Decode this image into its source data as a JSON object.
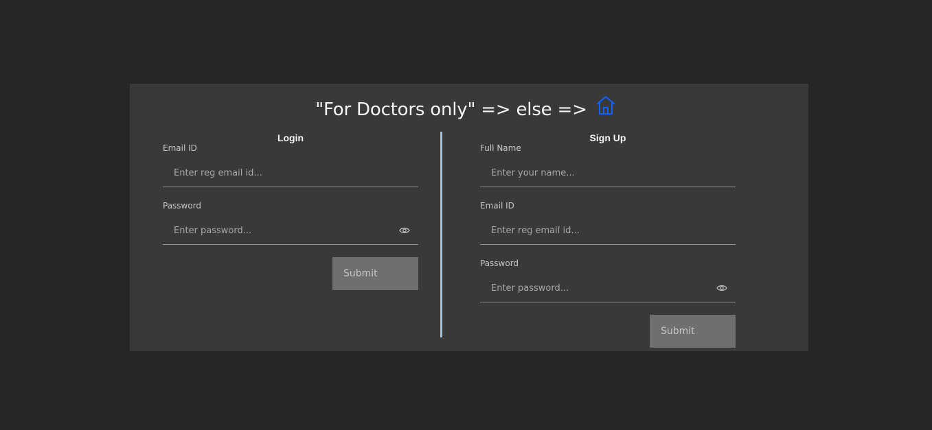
{
  "header": {
    "title": "\"For Doctors only\" => else =>",
    "home_icon": "home-icon",
    "home_icon_color": "#0f62fe"
  },
  "login": {
    "title": "Login",
    "email_label": "Email ID",
    "email_placeholder": "Enter reg email id...",
    "email_value": "",
    "password_label": "Password",
    "password_placeholder": "Enter password...",
    "password_value": "",
    "password_toggle_icon": "eye-icon",
    "submit_label": "Submit"
  },
  "signup": {
    "title": "Sign Up",
    "name_label": "Full Name",
    "name_placeholder": "Enter your name...",
    "name_value": "",
    "email_label": "Email ID",
    "email_placeholder": "Enter reg email id...",
    "email_value": "",
    "password_label": "Password",
    "password_placeholder": "Enter password...",
    "password_value": "",
    "password_toggle_icon": "eye-icon",
    "submit_label": "Submit"
  },
  "colors": {
    "page_background": "#262626",
    "card_background": "#393939",
    "divider": "#9ec2d6",
    "button_background": "#6f6f6f"
  }
}
